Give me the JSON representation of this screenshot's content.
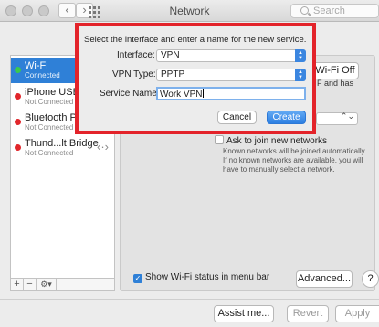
{
  "window": {
    "title": "Network"
  },
  "toolbar": {
    "back": "‹",
    "forward": "›",
    "search_placeholder": "Search"
  },
  "sidebar": {
    "items": [
      {
        "name": "Wi-Fi",
        "status": "Connected",
        "dot": "#3bc94e"
      },
      {
        "name": "iPhone USB",
        "status": "Not Connected",
        "dot": "#e1262b"
      },
      {
        "name": "Bluetooth PAN",
        "status": "Not Connected",
        "dot": "#e1262b"
      },
      {
        "name": "Thund...lt Bridge",
        "status": "Not Connected",
        "dot": "#e1262b"
      }
    ],
    "add": "+",
    "remove": "−",
    "action": "⚙▾"
  },
  "panel": {
    "wifi_off": "Wi-Fi Off",
    "hint1": "F and has",
    "ask_label": "Ask to join new networks",
    "known_text": "Known networks will be joined automatically. If no known networks are available, you will have to manually select a network.",
    "show_wifi": "Show Wi-Fi status in menu bar",
    "advanced": "Advanced...",
    "help": "?",
    "assist": "Assist me...",
    "revert": "Revert",
    "apply": "Apply"
  },
  "sheet": {
    "title": "Select the interface and enter a name for the new service.",
    "interface_label": "Interface:",
    "interface_value": "VPN",
    "vpn_type_label": "VPN Type:",
    "vpn_type_value": "PPTP",
    "service_name_label": "Service Name:",
    "service_name_value": "Work VPN",
    "cancel": "Cancel",
    "create": "Create"
  },
  "colors": {
    "accent": "#2f80d7",
    "highlight": "#e3232a"
  }
}
